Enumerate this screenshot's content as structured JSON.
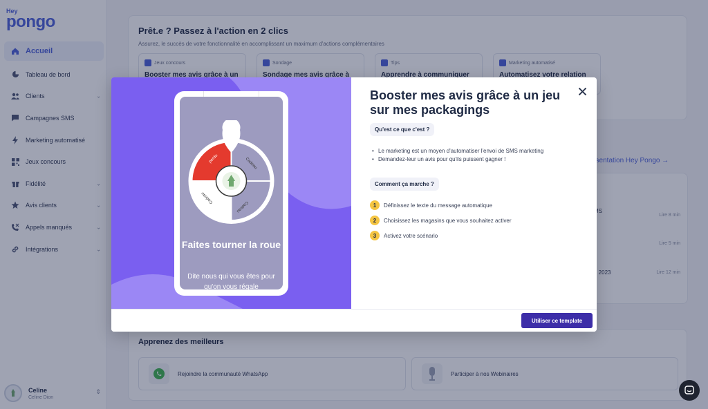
{
  "brand": {
    "hey": "Hey",
    "name": "pongo"
  },
  "sidebar": {
    "items": [
      {
        "label": "Accueil",
        "icon": "home-icon",
        "active": true
      },
      {
        "label": "Tableau de bord",
        "icon": "chart-pie-icon"
      },
      {
        "label": "Clients",
        "icon": "users-icon",
        "chevron": true
      },
      {
        "label": "Campagnes SMS",
        "icon": "chat-icon"
      },
      {
        "label": "Marketing automatisé",
        "icon": "bolt-icon"
      },
      {
        "label": "Jeux concours",
        "icon": "qr-icon"
      },
      {
        "label": "Fidélité",
        "icon": "gift-icon",
        "chevron": true
      },
      {
        "label": "Avis clients",
        "icon": "star-icon",
        "chevron": true
      },
      {
        "label": "Appels manqués",
        "icon": "phone-missed-icon",
        "chevron": true
      },
      {
        "label": "Intégrations",
        "icon": "link-icon",
        "chevron": true
      }
    ],
    "user": {
      "name": "Celine",
      "sub": "Celine Dion"
    }
  },
  "main": {
    "title": "Prêt.e ? Passez à l'action en 2 clics",
    "subtitle": "Assurez, le succès de votre fonctionnalité en accomplissant un maximum d'actions complémentaires",
    "cards": [
      {
        "tag": "Jeux concours",
        "title": "Booster mes avis grâce à un"
      },
      {
        "tag": "Sondage",
        "title": "Sondage mes avis grâce à"
      },
      {
        "tag": "Tips",
        "title": "Apprendre à communiquer"
      },
      {
        "tag": "Marketing automatisé",
        "title": "Automatisez votre relation"
      }
    ],
    "presentation_link": "ésentation Hey Pongo →",
    "bg_rows": [
      {
        "text": "MS",
        "read": "Lire 8 min"
      },
      {
        "text": "",
        "read": "Lire 5 min"
      },
      {
        "text": "n 2023",
        "read": "Lire 12 min"
      }
    ],
    "learn_title": "Apprenez des meilleurs",
    "community": [
      {
        "label": "Rejoindre la communauté WhatsApp",
        "icon": "whatsapp-icon"
      },
      {
        "label": "Participer à nos Webinaires",
        "icon": "microphone-icon"
      }
    ]
  },
  "modal": {
    "title": "Booster mes avis grâce à un jeu sur mes packagings",
    "what_label": "Qu'est ce que c'est ?",
    "bullets": [
      "Le marketing est un moyen d'automatiser l'envoi de SMS marketing",
      "Demandez-leur un avis pour qu'ils puissent gagner !"
    ],
    "how_label": "Comment ça marche ?",
    "steps": [
      {
        "num": "1",
        "text": "Définissez le texte du message automatique"
      },
      {
        "num": "2",
        "text": "Choisissez les magasins que vous souhaitez activer"
      },
      {
        "num": "3",
        "text": "Activez votre scénario"
      }
    ],
    "phone": {
      "title": "Faites tourner la roue",
      "subtitle": "Dite nous qui vous êtes pour qu'on vous régale",
      "wheel_segments": [
        "perdu",
        "Cadeau",
        "Cadeau",
        "Cadeau"
      ]
    },
    "cta": "Utiliser ce template",
    "close_icon": "close-icon"
  },
  "colors": {
    "accent": "#4a5fd8",
    "hero": "#7a5ff0",
    "cta": "#3d2ea8",
    "step": "#f5c542"
  }
}
